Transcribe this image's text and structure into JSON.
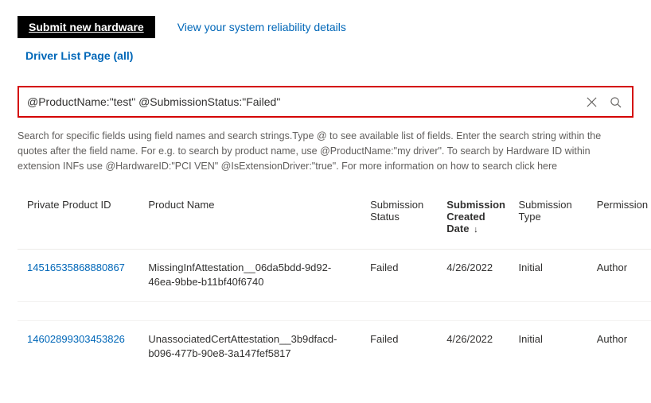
{
  "topbar": {
    "submit_label": "Submit new hardware",
    "reliability_label": "View your system reliability details"
  },
  "subnav": {
    "driver_list_label": "Driver List Page (all)"
  },
  "search": {
    "value": "@ProductName:\"test\" @SubmissionStatus:\"Failed\""
  },
  "help": {
    "text": "Search for specific fields using field names and search strings.Type @ to see available list of fields. Enter the search string within the quotes after the field name. For e.g. to search by product name, use @ProductName:\"my driver\". To search by Hardware ID within extension INFs use @HardwareID:\"PCI VEN\" @IsExtensionDriver:\"true\". For more information on how to search click ",
    "here_label": "here"
  },
  "table": {
    "headers": {
      "id": "Private Product ID",
      "name": "Product Name",
      "status": "Submission Status",
      "date": "Submission Created Date",
      "type": "Submission Type",
      "perm": "Permission"
    },
    "sort_indicator": "↓",
    "rows": [
      {
        "id": "14516535868880867",
        "name": "MissingInfAttestation__06da5bdd-9d92-46ea-9bbe-b11bf40f6740",
        "status": "Failed",
        "date": "4/26/2022",
        "type": "Initial",
        "perm": "Author"
      },
      {
        "id": "14602899303453826",
        "name": "UnassociatedCertAttestation__3b9dfacd-b096-477b-90e8-3a147fef5817",
        "status": "Failed",
        "date": "4/26/2022",
        "type": "Initial",
        "perm": "Author"
      }
    ]
  }
}
